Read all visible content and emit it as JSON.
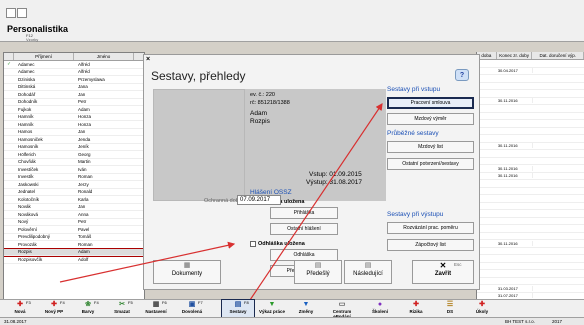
{
  "app": {
    "title": "Personalistika",
    "sub_key": "F12",
    "sub_label": "Vzorky"
  },
  "list": {
    "columns": [
      "Příjmení",
      "Jméno"
    ],
    "rows": [
      [
        "Adamec",
        "Alfréd"
      ],
      [
        "Adamec",
        "Alfréd"
      ],
      [
        "Dziniska",
        "Przemyslawa"
      ],
      [
        "Dittinská",
        "Jana"
      ],
      [
        "Dohodář",
        "Jan"
      ],
      [
        "Dohodník",
        "Petr"
      ],
      [
        "Fujkok",
        "Adam"
      ],
      [
        "Hamník",
        "Honza"
      ],
      [
        "Hamník",
        "Honza"
      ],
      [
        "Hamos",
        "Jan"
      ],
      [
        "Hamosniček",
        "Jenda"
      ],
      [
        "Hamosník",
        "Jeník"
      ],
      [
        "Hölferich",
        "Georg"
      ],
      [
        "Chovňák",
        "Martin"
      ],
      [
        "Investíček",
        "Iván"
      ],
      [
        "Investík",
        "Roman"
      ],
      [
        "Jaskowski",
        "Jerzy"
      ],
      [
        "Jednatel",
        "Ronald"
      ],
      [
        "Kolotočník",
        "Karla"
      ],
      [
        "Novák",
        "Jan"
      ],
      [
        "Nováková",
        "Anna"
      ],
      [
        "Nový",
        "Petr"
      ],
      [
        "Polověrní",
        "Pavel"
      ],
      [
        "Prevdilipodobný",
        "Tomáš"
      ],
      [
        "Provozák",
        "Roman"
      ],
      [
        "Rozpis",
        "Adam"
      ],
      [
        "Rozpisovčík",
        "Adolf"
      ]
    ]
  },
  "right": {
    "columns": [
      "doba",
      "Konec zr. doby",
      "Dat. doručení výp."
    ],
    "values": [
      "",
      "30.04.2017",
      "",
      "",
      "",
      "30.11.2016",
      "",
      "",
      "",
      "",
      "",
      "30.11.2016",
      "",
      "",
      "30.11.2016",
      "30.11.2016",
      "",
      "",
      "",
      "",
      "",
      "",
      "",
      "",
      "30.11.2016",
      "",
      "",
      "",
      "",
      "",
      "31.03.2017",
      "31.07.2017",
      "",
      "",
      "",
      "",
      "30.04.2017",
      "",
      "",
      "30.11.2016",
      "",
      ""
    ]
  },
  "dialog": {
    "close": "×",
    "title": "Sestavy, přehledy",
    "info_icon": "?",
    "ev_c": "ev. č.: 220",
    "rc": "rč: 851218/1388",
    "name": "Adam",
    "role": "Rozpis",
    "vstup": "Vstup: 01.09.2015",
    "vystup": "Výstup: 31.08.2017",
    "hlaseni_title": "Hlášení OSSZ",
    "prihlaska_check": "✓",
    "prihlaska_label": "Přihláška uložena",
    "prihlaska_btn": "Přihláška",
    "ostatni_hlaseni": "Ostatní hlášení",
    "odhlaska_label": "Odhláška uložena",
    "odhlaska_btn": "Odhláška",
    "prehled_hlaseni": "Přehled hlášení",
    "ochranna_label": "Ochranná doba do:",
    "ochranna_value": "07.09.2017",
    "vstup_title": "Sestavy při vstupu",
    "pracovni_smlouva": "Pracovní smlouva",
    "mzdovy_vymer": "Mzdový výměr",
    "prubezne_title": "Průběžné sestavy",
    "mzdovy_list": "Mzdový list",
    "ostatni_potvrzeni": "Ostatní potvrzení/sestavy",
    "vystup_title": "Sestavy při výstupu",
    "rozvazani": "Rozvázání prac. poměru",
    "zapoctovy": "Zápočtový list",
    "dokumenty": "Dokumenty",
    "predesly": "Předešlý",
    "nasledujici": "Následující",
    "zavrit": "Zavřít",
    "esc": "Esc"
  },
  "toolbar": {
    "items": [
      {
        "key": "F3",
        "label": "Nová"
      },
      {
        "key": "F4",
        "label": "Nový PP"
      },
      {
        "key": "F4",
        "label": "Barvy"
      },
      {
        "key": "F5",
        "label": "Smazat"
      },
      {
        "key": "F6",
        "label": "Nastavení"
      },
      {
        "key": "F7",
        "label": "Dovolená"
      },
      {
        "key": "F8",
        "label": "Sestavy"
      },
      {
        "key": "",
        "label": "Výkaz práce"
      },
      {
        "key": "",
        "label": "Změny"
      },
      {
        "key": "",
        "label": "Centrum ePodání"
      },
      {
        "key": "",
        "label": "Školení"
      },
      {
        "key": "",
        "label": "Rizika"
      },
      {
        "key": "",
        "label": "DS"
      },
      {
        "key": "",
        "label": "Úkoly"
      }
    ]
  },
  "status": {
    "date": "31.08.2017",
    "company": "BH TEST s.r.o.",
    "year": "2017"
  },
  "colors": {
    "accent": "#1a4fb5",
    "arrow": "#d83030"
  }
}
